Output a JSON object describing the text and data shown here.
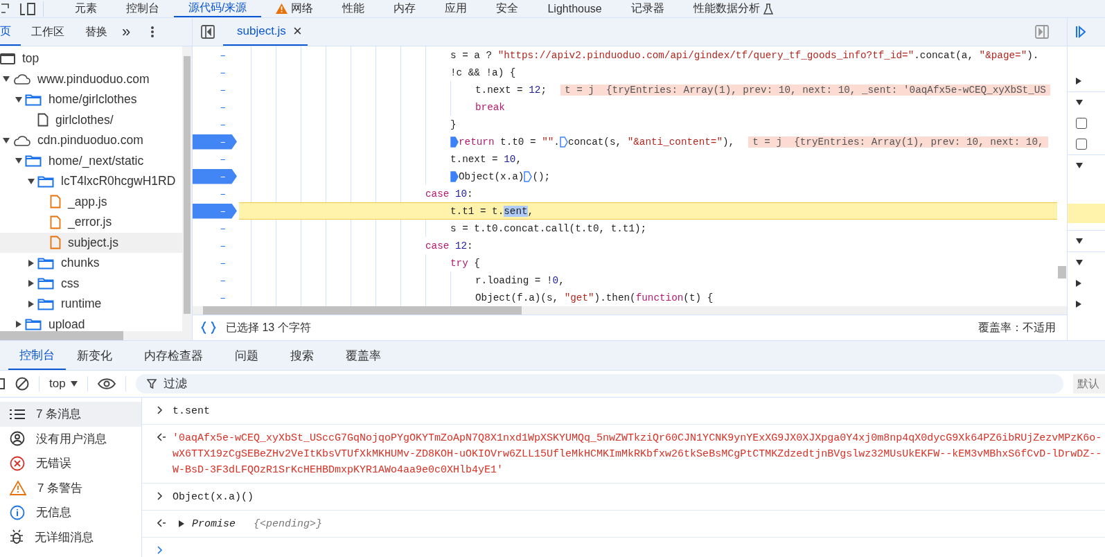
{
  "main_tabs": [
    {
      "label": "元素",
      "selected": false
    },
    {
      "label": "控制台",
      "selected": false
    },
    {
      "label": "源代码/来源",
      "selected": true
    },
    {
      "label": "网络",
      "selected": false,
      "warning": true
    },
    {
      "label": "性能",
      "selected": false
    },
    {
      "label": "内存",
      "selected": false
    },
    {
      "label": "应用",
      "selected": false
    },
    {
      "label": "安全",
      "selected": false
    },
    {
      "label": "Lighthouse",
      "selected": false
    },
    {
      "label": "记录器",
      "selected": false
    },
    {
      "label": "性能数据分析",
      "selected": false,
      "experimental": true
    }
  ],
  "navigator_tabs": [
    {
      "label": "页",
      "selected": true
    },
    {
      "label": "工作区",
      "selected": false
    },
    {
      "label": "替换",
      "selected": false
    }
  ],
  "more_tabs": "»",
  "file_tree": [
    {
      "label": "top",
      "kind": "frame",
      "selected": false,
      "children": [
        {
          "label": "www.pinduoduo.com",
          "kind": "domain",
          "expanded": true,
          "selected": false,
          "children": [
            {
              "label": "home/girlclothes",
              "kind": "folder",
              "expanded": true,
              "selected": false,
              "children": [
                {
                  "label": "girlclothes/",
                  "kind": "document",
                  "selected": false
                }
              ]
            }
          ]
        },
        {
          "label": "cdn.pinduoduo.com",
          "kind": "domain",
          "expanded": true,
          "selected": false,
          "children": [
            {
              "label": "home/_next/static",
              "kind": "folder",
              "expanded": true,
              "selected": false,
              "children": [
                {
                  "label": "lcT4lxcR0hcgwH1RD",
                  "kind": "folder",
                  "expanded": true,
                  "selected": false,
                  "children": [
                    {
                      "label": "_app.js",
                      "kind": "script",
                      "selected": false
                    },
                    {
                      "label": "_error.js",
                      "kind": "script",
                      "selected": false
                    },
                    {
                      "label": "subject.js",
                      "kind": "script",
                      "selected": true
                    }
                  ]
                },
                {
                  "label": "chunks",
                  "kind": "folder",
                  "expanded": false,
                  "selected": false
                },
                {
                  "label": "css",
                  "kind": "folder",
                  "expanded": false,
                  "selected": false
                },
                {
                  "label": "runtime",
                  "kind": "folder",
                  "expanded": false,
                  "selected": false
                }
              ]
            },
            {
              "label": "upload",
              "kind": "folder",
              "expanded": false,
              "selected": false
            }
          ]
        }
      ]
    }
  ],
  "editor_tabs": [
    {
      "label": "subject.js",
      "selected": true,
      "close": "×"
    }
  ],
  "code_lines": [
    {
      "kind": "statement",
      "gutter": "–",
      "breakpoint": false,
      "current": false,
      "parts": [
        {
          "kind": "code",
          "tokens": [
            {
              "text": "s = a ? ",
              "kind": "plain"
            },
            {
              "text": "\"https://apiv2.pinduoduo.com/api/gindex/tf/query_tf_goods_info?tf_id=\"",
              "kind": "str"
            },
            {
              "text": ".concat(a, ",
              "kind": "plain"
            },
            {
              "text": "\"&page=\"",
              "kind": "str"
            },
            {
              "text": ").",
              "kind": "plain"
            }
          ]
        }
      ]
    },
    {
      "kind": "statement",
      "gutter": "–",
      "breakpoint": false,
      "current": false,
      "parts": [
        {
          "kind": "code",
          "tokens": [
            {
              "text": "!c && !a) {",
              "kind": "plain"
            }
          ]
        }
      ]
    },
    {
      "kind": "nested",
      "gutter": "–",
      "breakpoint": false,
      "current": false,
      "parts": [
        {
          "kind": "code",
          "tokens": [
            {
              "text": "t.next = ",
              "kind": "plain"
            },
            {
              "text": "12",
              "kind": "num"
            },
            {
              "text": ";",
              "kind": "plain"
            }
          ]
        },
        {
          "kind": "value",
          "text": "t = j  {tryEntries: Array(1), prev: 10, next: 10, _sent: '0aqAfx5e-wCEQ_xyXbSt_US"
        }
      ]
    },
    {
      "kind": "nested",
      "gutter": "–",
      "breakpoint": false,
      "current": false,
      "parts": [
        {
          "kind": "code",
          "tokens": [
            {
              "text": "break",
              "kind": "kw"
            }
          ]
        }
      ]
    },
    {
      "kind": "statement",
      "gutter": "–",
      "breakpoint": false,
      "current": false,
      "parts": [
        {
          "kind": "code",
          "tokens": [
            {
              "text": "}",
              "kind": "plain"
            }
          ]
        }
      ]
    },
    {
      "kind": "statement",
      "gutter": "–",
      "breakpoint": true,
      "current": false,
      "parts": [
        {
          "kind": "marker",
          "active": true
        },
        {
          "kind": "code",
          "tokens": [
            {
              "text": "return",
              "kind": "kw"
            },
            {
              "text": " t.t0 = ",
              "kind": "plain"
            },
            {
              "text": "\"\"",
              "kind": "str"
            },
            {
              "text": ".",
              "kind": "plain"
            }
          ]
        },
        {
          "kind": "marker",
          "active": false
        },
        {
          "kind": "code",
          "tokens": [
            {
              "text": "concat(s, ",
              "kind": "plain"
            },
            {
              "text": "\"&anti_content=\"",
              "kind": "str"
            },
            {
              "text": "),",
              "kind": "plain"
            }
          ]
        },
        {
          "kind": "value",
          "text": "t = j  {tryEntries: Array(1), prev: 10, next: 10,"
        }
      ]
    },
    {
      "kind": "statement",
      "gutter": "–",
      "breakpoint": false,
      "current": false,
      "parts": [
        {
          "kind": "code",
          "tokens": [
            {
              "text": "t.next = ",
              "kind": "plain"
            },
            {
              "text": "10",
              "kind": "num"
            },
            {
              "text": ",",
              "kind": "plain"
            }
          ]
        }
      ]
    },
    {
      "kind": "statement",
      "gutter": "–",
      "breakpoint": true,
      "current": false,
      "parts": [
        {
          "kind": "marker",
          "active": true
        },
        {
          "kind": "code",
          "tokens": [
            {
              "text": "Object(x.a)",
              "kind": "plain"
            }
          ]
        },
        {
          "kind": "marker",
          "active": false
        },
        {
          "kind": "code",
          "tokens": [
            {
              "text": "();",
              "kind": "plain"
            }
          ]
        }
      ]
    },
    {
      "kind": "case",
      "gutter": "–",
      "breakpoint": false,
      "current": false,
      "parts": [
        {
          "kind": "code",
          "tokens": [
            {
              "text": "case ",
              "kind": "kw"
            },
            {
              "text": "10",
              "kind": "num"
            },
            {
              "text": ":",
              "kind": "plain"
            }
          ]
        }
      ]
    },
    {
      "kind": "statement",
      "gutter": "–",
      "breakpoint": true,
      "current": true,
      "parts": [
        {
          "kind": "code",
          "tokens": [
            {
              "text": "t.t1 = t.",
              "kind": "plain"
            },
            {
              "text": "sent",
              "kind": "selection"
            },
            {
              "text": ",",
              "kind": "plain"
            }
          ]
        }
      ]
    },
    {
      "kind": "statement",
      "gutter": "–",
      "breakpoint": false,
      "current": false,
      "parts": [
        {
          "kind": "code",
          "tokens": [
            {
              "text": "s = t.t0.concat.call(t.t0, t.t1);",
              "kind": "plain"
            }
          ]
        }
      ]
    },
    {
      "kind": "case",
      "gutter": "–",
      "breakpoint": false,
      "current": false,
      "parts": [
        {
          "kind": "code",
          "tokens": [
            {
              "text": "case ",
              "kind": "kw"
            },
            {
              "text": "12",
              "kind": "num"
            },
            {
              "text": ":",
              "kind": "plain"
            }
          ]
        }
      ]
    },
    {
      "kind": "statement",
      "gutter": "–",
      "breakpoint": false,
      "current": false,
      "parts": [
        {
          "kind": "code",
          "tokens": [
            {
              "text": "try",
              "kind": "kw"
            },
            {
              "text": " {",
              "kind": "plain"
            }
          ]
        }
      ]
    },
    {
      "kind": "nested",
      "gutter": "–",
      "breakpoint": false,
      "current": false,
      "parts": [
        {
          "kind": "code",
          "tokens": [
            {
              "text": "r.loading = !",
              "kind": "plain"
            },
            {
              "text": "0",
              "kind": "num"
            },
            {
              "text": ",",
              "kind": "plain"
            }
          ]
        }
      ]
    },
    {
      "kind": "nested",
      "gutter": "–",
      "breakpoint": false,
      "current": false,
      "parts": [
        {
          "kind": "code",
          "tokens": [
            {
              "text": "Object(f.a)(s, ",
              "kind": "plain"
            },
            {
              "text": "\"get\"",
              "kind": "str"
            },
            {
              "text": ").then(",
              "kind": "plain"
            },
            {
              "text": "function",
              "kind": "kw"
            },
            {
              "text": "(t) {",
              "kind": "plain"
            }
          ]
        }
      ]
    }
  ],
  "status_bar": {
    "selection": "已选择 13 个字符",
    "coverage": "覆盖率：不适用"
  },
  "right_panel": [
    {
      "kind": "collapsed"
    },
    {
      "kind": "expanded"
    },
    {
      "kind": "checkbox",
      "checked": false
    },
    {
      "kind": "checkbox",
      "checked": false
    },
    {
      "kind": "expanded"
    },
    {
      "kind": "highlight"
    },
    {
      "kind": "expanded"
    },
    {
      "kind": "expanded"
    },
    {
      "kind": "collapsed"
    },
    {
      "kind": "collapsed"
    }
  ],
  "drawer_tabs": [
    {
      "label": "控制台",
      "selected": true
    },
    {
      "label": "新变化",
      "selected": false
    },
    {
      "label": "内存检查器",
      "selected": false
    },
    {
      "label": "问题",
      "selected": false
    },
    {
      "label": "搜索",
      "selected": false
    },
    {
      "label": "覆盖率",
      "selected": false
    }
  ],
  "console_toolbar": {
    "context": "top",
    "filter_placeholder": "过滤",
    "levels": "默认"
  },
  "console_sidebar": [
    {
      "label": "7 条消息",
      "kind": "list",
      "selected": true
    },
    {
      "label": "没有用户消息",
      "kind": "user",
      "selected": false
    },
    {
      "label": "无错误",
      "kind": "error",
      "selected": false
    },
    {
      "label": "7 条警告",
      "kind": "warning",
      "selected": false
    },
    {
      "label": "无信息",
      "kind": "info",
      "selected": false
    },
    {
      "label": "无详细消息",
      "kind": "verbose",
      "selected": false
    }
  ],
  "console_messages": [
    {
      "kind": "input",
      "lines": [
        "t.sent"
      ]
    },
    {
      "kind": "string",
      "lines": [
        "'0aqAfx5e-wCEQ_xyXbSt_USccG7GqNojqoPYgOKYTmZoApN7Q8X1nxd1WpXSKYUMQq_5nwZWTkziQr60CJN1YCNK9ynYExXG9JX0XJXpga0Y4xj0m8np4qX0dycG9Xk64PZ6ibRUjZezvMPzK6o-",
        "wX6TTX19zCgSEBeZHv2VeItKbsVTUfXkMKHUMv-ZD8KOH-uOKIOVrw6ZLL15UfleMkHCMKImMkRKbfxw26tkSeBsMCgPtCTMKZdzedtjnBVgslwz32MUsUkEKFW--kEM3vMBhxS6fCvD-lDrwDZ--",
        "W-BsD-3F3dLFQOzR1SrKcHEHBDmxpKYR1AWo4aa9e0c0XHlb4yE1'"
      ]
    },
    {
      "kind": "input",
      "lines": [
        "Object(x.a)()"
      ]
    },
    {
      "kind": "object",
      "lines": [
        "Promise"
      ],
      "detail": "{<pending>}",
      "expanded": false
    }
  ]
}
